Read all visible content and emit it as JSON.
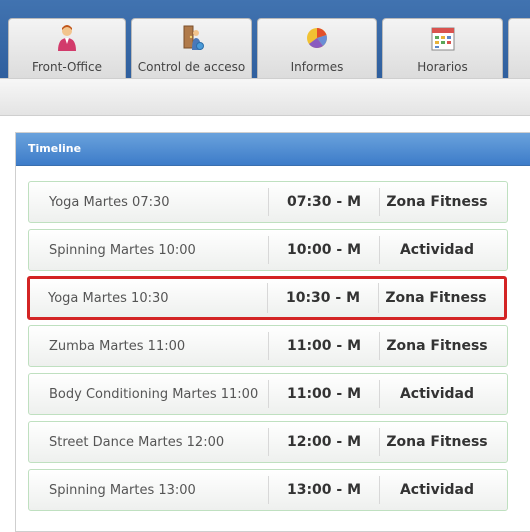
{
  "tabs": [
    {
      "label": "Front-Office",
      "icon": "user-icon"
    },
    {
      "label": "Control de acceso",
      "icon": "access-control-icon"
    },
    {
      "label": "Informes",
      "icon": "pie-chart-icon"
    },
    {
      "label": "Horarios",
      "icon": "calendar-icon"
    },
    {
      "label": "",
      "icon": "partial-tab-icon"
    }
  ],
  "timeline": {
    "title": "Timeline",
    "rows": [
      {
        "name": "Yoga Martes 07:30",
        "time": "07:30 - M",
        "zone": "Zona Fitness",
        "selected": false
      },
      {
        "name": "Spinning Martes 10:00",
        "time": "10:00 - M",
        "zone": "Actividad",
        "selected": false
      },
      {
        "name": "Yoga Martes 10:30",
        "time": "10:30 - M",
        "zone": "Zona Fitness",
        "selected": true
      },
      {
        "name": "Zumba Martes 11:00",
        "time": "11:00 - M",
        "zone": "Zona Fitness",
        "selected": false
      },
      {
        "name": "Body Conditioning Martes 11:00",
        "time": "11:00 - M",
        "zone": "Actividad",
        "selected": false
      },
      {
        "name": "Street Dance Martes 12:00",
        "time": "12:00 - M",
        "zone": "Zona Fitness",
        "selected": false
      },
      {
        "name": "Spinning Martes 13:00",
        "time": "13:00 - M",
        "zone": "Actividad",
        "selected": false
      }
    ]
  },
  "colors": {
    "header_blue": "#3d7cc9",
    "selected_border": "#d32424",
    "row_border": "#bfe0c0"
  }
}
